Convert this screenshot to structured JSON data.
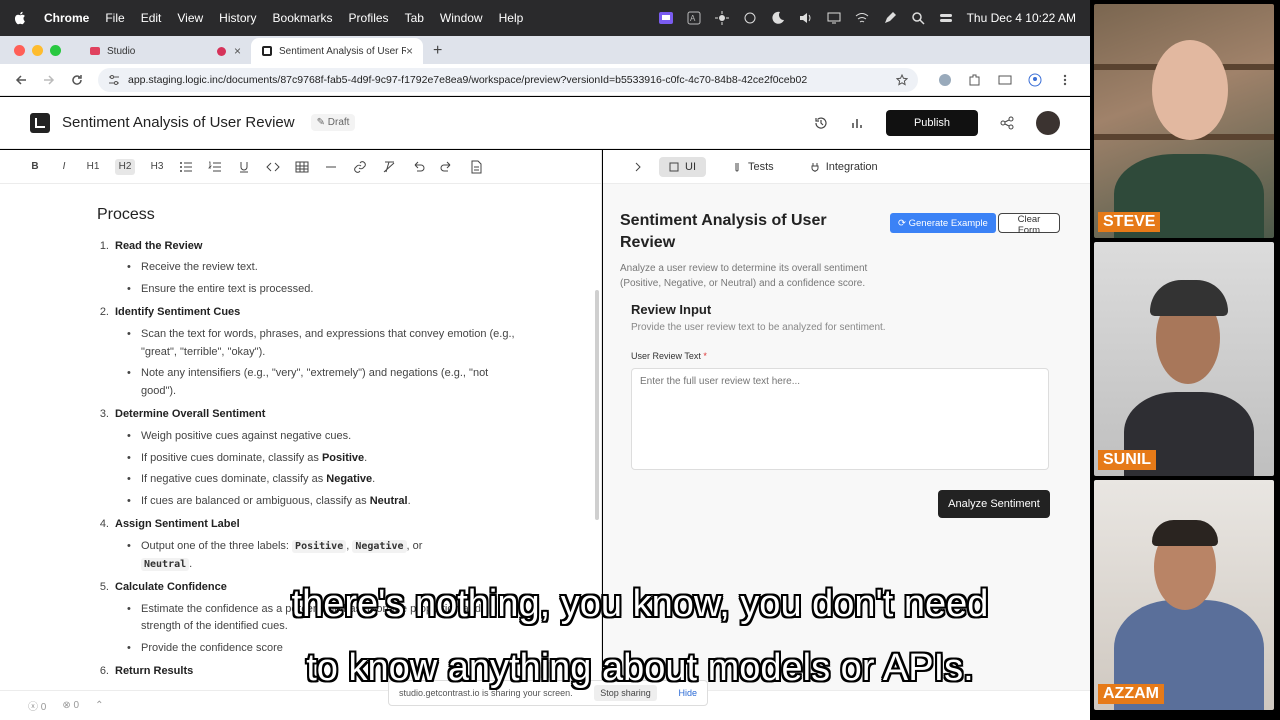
{
  "menubar": {
    "app": "Chrome",
    "items": [
      "File",
      "Edit",
      "View",
      "History",
      "Bookmarks",
      "Profiles",
      "Tab",
      "Window",
      "Help"
    ],
    "clock": "Thu Dec 4  10:22 AM"
  },
  "tabs": [
    {
      "title": "Studio"
    },
    {
      "title": "Sentiment Analysis of User R"
    }
  ],
  "address": {
    "url": "app.staging.logic.inc/documents/87c9768f-fab5-4d9f-9c97-f1792e7e8ea9/workspace/preview?versionId=b5533916-c0fc-4c70-84b8-42ce2f0ceb02"
  },
  "header": {
    "title": "Sentiment Analysis of User Review",
    "badge": "Draft",
    "publish": "Publish"
  },
  "toolbar": {
    "h1": "H1",
    "h2": "H2",
    "h3": "H3"
  },
  "doc": {
    "heading": "Process",
    "steps": [
      {
        "num": "1.",
        "title": "Read the Review",
        "bullets": [
          "Receive the review text.",
          "Ensure the entire text is processed."
        ]
      },
      {
        "num": "2.",
        "title": "Identify Sentiment Cues",
        "bullets": [
          "Scan the text for words, phrases, and expressions that convey emotion (e.g., \"great\", \"terrible\", \"okay\").",
          "Note any intensifiers (e.g., \"very\", \"extremely\") and negations (e.g., \"not good\")."
        ]
      },
      {
        "num": "3.",
        "title": "Determine Overall Sentiment",
        "bullets": [
          "Weigh positive cues against negative cues."
        ]
      },
      {
        "num": "4.",
        "title": "Assign Sentiment Label"
      },
      {
        "num": "5.",
        "title": "Calculate Confidence",
        "bullets": [
          "Estimate the confidence as a percentage based on the proportion and strength of the identified cues.",
          "Provide the confidence score"
        ]
      },
      {
        "num": "6.",
        "title": "Return Results"
      }
    ],
    "s3b2_pre": "If positive cues dominate, classify as ",
    "s3b2_bold": "Positive",
    "s3b3_pre": "If negative cues dominate, classify as ",
    "s3b3_bold": "Negative",
    "s3b4_pre": "If cues are balanced or ambiguous, classify as ",
    "s3b4_bold": "Neutral",
    "s4b1_pre": "Output one of the three labels: ",
    "s4b1_c1": "Positive",
    "s4b1_c2": "Negative",
    "s4b1_or": ", or",
    "s4b1_c3": "Neutral"
  },
  "preview": {
    "tabs": [
      "UI",
      "Tests",
      "Integration"
    ],
    "title": "Sentiment Analysis of User Review",
    "description": "Analyze a user review to determine its overall sentiment (Positive, Negative, or Neutral) and a confidence score.",
    "generate": "Generate Example",
    "clear": "Clear Form",
    "section_title": "Review Input",
    "section_sub": "Provide the user review text to be analyzed for sentiment.",
    "field_label": "User Review Text",
    "required_mark": "*",
    "placeholder": "Enter the full user review text here...",
    "analyze": "Analyze Sentiment"
  },
  "footer": {
    "errors": "0",
    "warnings": "0"
  },
  "sharebar": {
    "text": "studio.getcontrast.io is sharing your screen.",
    "stop": "Stop sharing",
    "hide": "Hide"
  },
  "caption": {
    "line1": "there's nothing, you know, you don't need",
    "line2": "to know anything about models or APIs."
  },
  "participants": [
    {
      "name": "STEVE"
    },
    {
      "name": "SUNIL"
    },
    {
      "name": "AZZAM"
    }
  ]
}
